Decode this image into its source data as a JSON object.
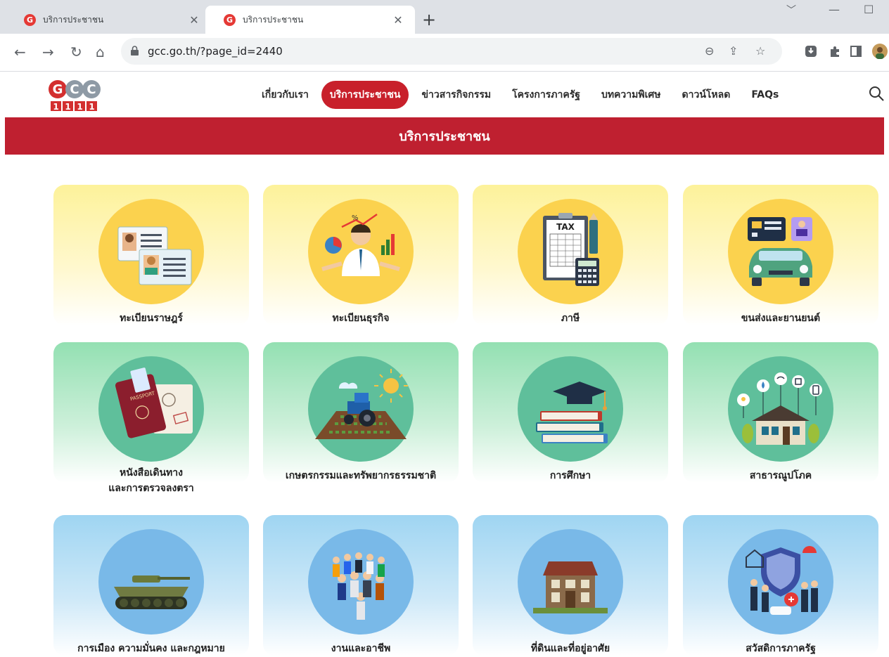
{
  "browser": {
    "tabs": [
      {
        "title": "บริการประชาชน",
        "favicon": "G"
      },
      {
        "title": "บริการประชาชน",
        "favicon": "G"
      }
    ],
    "url": "gcc.go.th/?page_id=2440"
  },
  "site": {
    "logo_text": "GCC",
    "logo_digits": [
      "1",
      "1",
      "1",
      "1"
    ],
    "menu": [
      "เกี่ยวกับเรา",
      "บริการประชาชน",
      "ข่าวสารกิจกรรม",
      "โครงการภาครัฐ",
      "บทความพิเศษ",
      "ดาวน์โหลด",
      "FAQs"
    ],
    "active_menu": "บริการประชาชน",
    "banner_title": "บริการประชาชน",
    "accent_color": "#bf2030"
  },
  "services": [
    {
      "label": "ทะเบียนราษฎร์",
      "icon": "id-cards-icon"
    },
    {
      "label": "ทะเบียนธุรกิจ",
      "icon": "business-man-icon"
    },
    {
      "label": "ภาษี",
      "icon": "tax-document-icon"
    },
    {
      "label": "ขนส่งและยานยนต์",
      "icon": "car-icon"
    },
    {
      "label": "หนังสือเดินทาง",
      "label2": "และการตรวจลงตรา",
      "icon": "passport-icon"
    },
    {
      "label": "เกษตรกรรมและทรัพยากรธรรมชาติ",
      "icon": "tractor-icon"
    },
    {
      "label": "การศึกษา",
      "icon": "books-icon"
    },
    {
      "label": "สาธารณูปโภค",
      "icon": "house-utilities-icon"
    },
    {
      "label": "การเมือง ความมั่นคง และกฎหมาย",
      "icon": "tank-icon"
    },
    {
      "label": "งานและอาชีพ",
      "icon": "workers-icon"
    },
    {
      "label": "ที่ดินและที่อยู่อาศัย",
      "icon": "building-icon"
    },
    {
      "label": "สวัสดิการภาครัฐ",
      "icon": "welfare-shield-icon"
    }
  ]
}
